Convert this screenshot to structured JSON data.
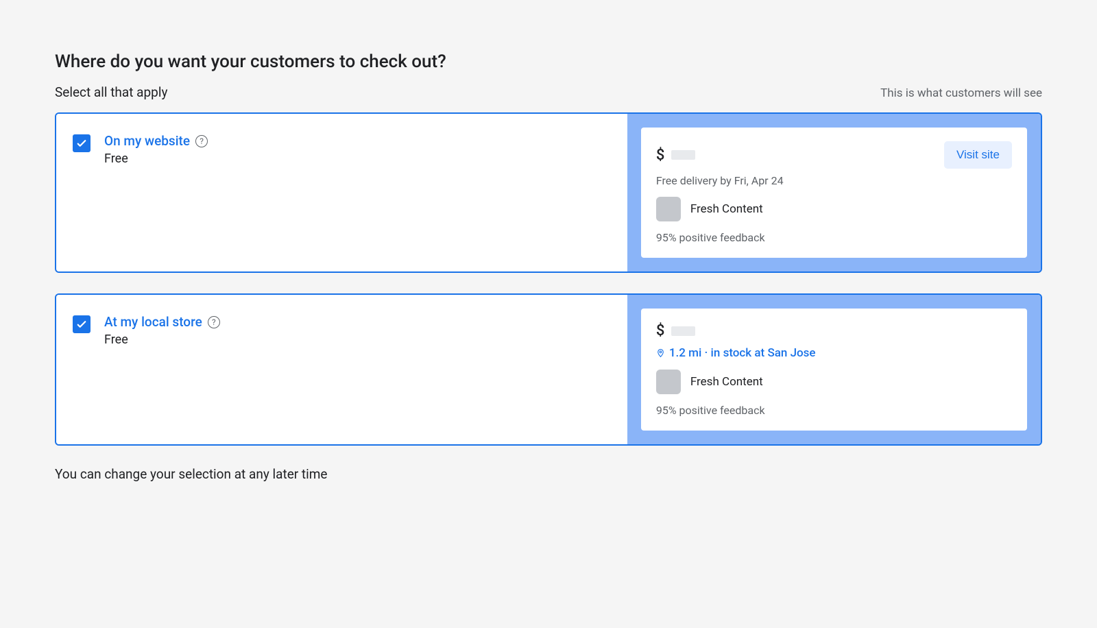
{
  "header": {
    "title": "Where do you want your customers to check out?",
    "subtitle": "Select all that apply",
    "preview_label": "This is what customers will see"
  },
  "options": [
    {
      "checked": true,
      "title": "On my website",
      "sub": "Free",
      "preview": {
        "dollar": "$",
        "delivery_text": "Free delivery by Fri, Apr 24",
        "visit_button": "Visit site",
        "merchant_name": "Fresh Content",
        "feedback": "95% positive feedback"
      }
    },
    {
      "checked": true,
      "title": "At my local store",
      "sub": "Free",
      "preview": {
        "dollar": "$",
        "stock_text": "1.2 mi · in stock at San Jose",
        "merchant_name": "Fresh Content",
        "feedback": "95% positive feedback"
      }
    }
  ],
  "footer_note": "You can change your selection at any later time"
}
